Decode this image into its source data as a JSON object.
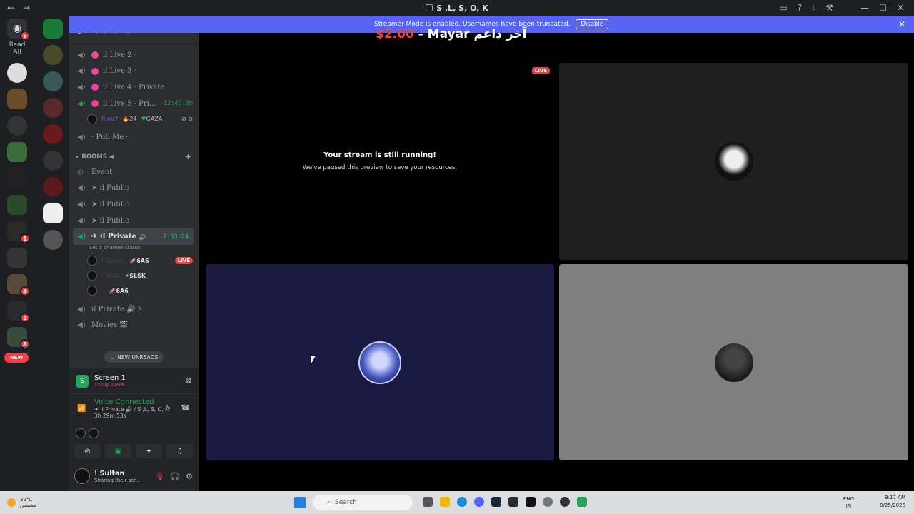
{
  "window": {
    "title": "S ,L, S, O, K",
    "nav_back": "←",
    "nav_forward": "→"
  },
  "titlebar_icons": {
    "inbox": "▭",
    "help": "?",
    "download": "⤓",
    "tools": "⚒",
    "minimize": "—",
    "maximize": "☐",
    "close": "✕"
  },
  "guilds": {
    "discord_badge": "6",
    "read_all": "Read All",
    "new_label": "NEW",
    "badges": [
      "1",
      "4",
      "1",
      "8"
    ]
  },
  "server": {
    "name": "S ,L, S, O, K",
    "chevron": "⌄"
  },
  "channels": [
    {
      "name": "ıl Live 2 ·"
    },
    {
      "name": "ıl Live 3 ·"
    },
    {
      "name": "ıl Live 4 · Private"
    },
    {
      "name": "ıl Live 5 · Pri...",
      "timer": "12:40:00"
    },
    {
      "name": "· Pull Me ·"
    }
  ],
  "live5_user": {
    "name": "Rma7",
    "count": "24",
    "tag": "GAZA"
  },
  "rooms_category": "ROOMS ◀",
  "room_channels": [
    {
      "name": "Event"
    },
    {
      "name": "➤ ıl Public"
    },
    {
      "name": "➤ ıl Public"
    },
    {
      "name": "➤ ıl Public"
    }
  ],
  "private_channel": {
    "name": "✈ ıl Private",
    "timer": "7:53:24",
    "status": "Set a channel status"
  },
  "private_users": [
    {
      "name": "! Sultan",
      "tag": "🚀6A6",
      "live": "LIVE"
    },
    {
      "name": "! SLSK",
      "tag": "⚡SLSK"
    },
    {
      "name": "·",
      "tag": "🚀6A6"
    }
  ],
  "more_channels": [
    {
      "name": "ıl Private 🔊 2"
    },
    {
      "name": "Movies 🎬"
    }
  ],
  "new_unreads": "NEW UNREADS",
  "screen_share": {
    "title": "Screen 1",
    "quality": "1440p 60FPS"
  },
  "voice": {
    "status": "Voice Connected",
    "channel": "✈ ıl Private 🔊 / S ,L, S, O, K",
    "duration": "3h 29m 53s"
  },
  "user": {
    "name": "! Sultan",
    "status": "Sharing their scr..."
  },
  "banner": {
    "text": "Streamer Mode is enabled. Usernames have been truncated.",
    "button": "Disable"
  },
  "overlay": {
    "amount": "$2.00",
    "text": " - Mayar آخر داعم"
  },
  "stream": {
    "live_badge": "LIVE",
    "message_title": "Your stream is still running!",
    "message_body": "We've paused this preview to save your resources."
  },
  "taskbar": {
    "temp": "32°C",
    "weather_sub": "مشمس",
    "search": "Search",
    "lang_top": "ENG",
    "lang_bottom": "IN",
    "time": "9:17 AM",
    "date": "8/25/2026"
  },
  "colors": {
    "accent": "#5865f2",
    "live": "#f23f43",
    "online": "#23a55a"
  }
}
